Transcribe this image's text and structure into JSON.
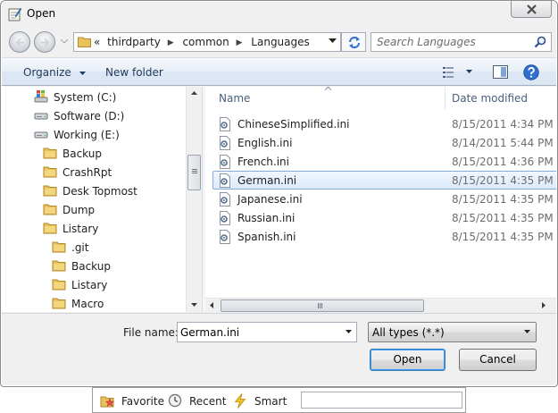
{
  "window": {
    "title": "Open",
    "close_tooltip": "Close"
  },
  "navigation": {
    "breadcrumb_overflow": "«",
    "breadcrumbs": [
      "thirdparty",
      "common",
      "Languages"
    ]
  },
  "search": {
    "placeholder": "Search Languages"
  },
  "toolbar": {
    "organize_label": "Organize",
    "new_folder_label": "New folder"
  },
  "tree": {
    "items": [
      {
        "label": "System (C:)",
        "icon": "windows-drive-icon",
        "level": 0
      },
      {
        "label": "Software (D:)",
        "icon": "drive-icon",
        "level": 0
      },
      {
        "label": "Working (E:)",
        "icon": "drive-icon",
        "level": 0
      },
      {
        "label": "Backup",
        "icon": "folder-icon",
        "level": 1
      },
      {
        "label": "CrashRpt",
        "icon": "folder-icon",
        "level": 1
      },
      {
        "label": "Desk Topmost",
        "icon": "folder-icon",
        "level": 1
      },
      {
        "label": "Dump",
        "icon": "folder-icon",
        "level": 1
      },
      {
        "label": "Listary",
        "icon": "folder-icon",
        "level": 1
      },
      {
        "label": ".git",
        "icon": "folder-icon",
        "level": 2
      },
      {
        "label": "Backup",
        "icon": "folder-icon",
        "level": 2
      },
      {
        "label": "Listary",
        "icon": "folder-icon",
        "level": 2
      },
      {
        "label": "Macro",
        "icon": "folder-icon",
        "level": 2
      }
    ]
  },
  "file_list": {
    "columns": {
      "name": "Name",
      "date": "Date modified"
    },
    "rows": [
      {
        "name": "ChineseSimplified.ini",
        "date": "8/15/2011 4:34 PM",
        "selected": false
      },
      {
        "name": "English.ini",
        "date": "8/14/2011 5:44 PM",
        "selected": false
      },
      {
        "name": "French.ini",
        "date": "8/15/2011 4:36 PM",
        "selected": false
      },
      {
        "name": "German.ini",
        "date": "8/15/2011 4:35 PM",
        "selected": true
      },
      {
        "name": "Japanese.ini",
        "date": "8/15/2011 4:35 PM",
        "selected": false
      },
      {
        "name": "Russian.ini",
        "date": "8/15/2011 4:35 PM",
        "selected": false
      },
      {
        "name": "Spanish.ini",
        "date": "8/15/2011 4:35 PM",
        "selected": false
      }
    ]
  },
  "footer": {
    "file_name_label": "File name:",
    "file_name_value": "German.ini",
    "file_type_value": "All types (*.*)",
    "open_label": "Open",
    "cancel_label": "Cancel"
  },
  "listary_bar": {
    "favorite_label": "Favorite",
    "recent_label": "Recent",
    "smart_label": "Smart",
    "input_value": ""
  },
  "colors": {
    "accent": "#3399ff",
    "selection_border": "#84acdd",
    "folder": "#e8c25a",
    "link_text": "#1e395b",
    "header_text": "#4c607a"
  }
}
